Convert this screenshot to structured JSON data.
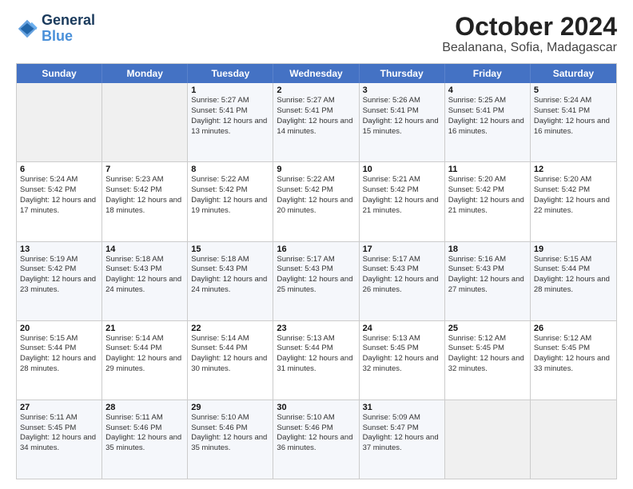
{
  "header": {
    "logo_line1": "General",
    "logo_line2": "Blue",
    "title": "October 2024",
    "subtitle": "Bealanana, Sofia, Madagascar"
  },
  "calendar": {
    "days_of_week": [
      "Sunday",
      "Monday",
      "Tuesday",
      "Wednesday",
      "Thursday",
      "Friday",
      "Saturday"
    ],
    "rows": [
      [
        {
          "day": "",
          "sunrise": "",
          "sunset": "",
          "daylight": "",
          "empty": true
        },
        {
          "day": "",
          "sunrise": "",
          "sunset": "",
          "daylight": "",
          "empty": true
        },
        {
          "day": "1",
          "sunrise": "Sunrise: 5:27 AM",
          "sunset": "Sunset: 5:41 PM",
          "daylight": "Daylight: 12 hours and 13 minutes."
        },
        {
          "day": "2",
          "sunrise": "Sunrise: 5:27 AM",
          "sunset": "Sunset: 5:41 PM",
          "daylight": "Daylight: 12 hours and 14 minutes."
        },
        {
          "day": "3",
          "sunrise": "Sunrise: 5:26 AM",
          "sunset": "Sunset: 5:41 PM",
          "daylight": "Daylight: 12 hours and 15 minutes."
        },
        {
          "day": "4",
          "sunrise": "Sunrise: 5:25 AM",
          "sunset": "Sunset: 5:41 PM",
          "daylight": "Daylight: 12 hours and 16 minutes."
        },
        {
          "day": "5",
          "sunrise": "Sunrise: 5:24 AM",
          "sunset": "Sunset: 5:41 PM",
          "daylight": "Daylight: 12 hours and 16 minutes."
        }
      ],
      [
        {
          "day": "6",
          "sunrise": "Sunrise: 5:24 AM",
          "sunset": "Sunset: 5:42 PM",
          "daylight": "Daylight: 12 hours and 17 minutes."
        },
        {
          "day": "7",
          "sunrise": "Sunrise: 5:23 AM",
          "sunset": "Sunset: 5:42 PM",
          "daylight": "Daylight: 12 hours and 18 minutes."
        },
        {
          "day": "8",
          "sunrise": "Sunrise: 5:22 AM",
          "sunset": "Sunset: 5:42 PM",
          "daylight": "Daylight: 12 hours and 19 minutes."
        },
        {
          "day": "9",
          "sunrise": "Sunrise: 5:22 AM",
          "sunset": "Sunset: 5:42 PM",
          "daylight": "Daylight: 12 hours and 20 minutes."
        },
        {
          "day": "10",
          "sunrise": "Sunrise: 5:21 AM",
          "sunset": "Sunset: 5:42 PM",
          "daylight": "Daylight: 12 hours and 21 minutes."
        },
        {
          "day": "11",
          "sunrise": "Sunrise: 5:20 AM",
          "sunset": "Sunset: 5:42 PM",
          "daylight": "Daylight: 12 hours and 21 minutes."
        },
        {
          "day": "12",
          "sunrise": "Sunrise: 5:20 AM",
          "sunset": "Sunset: 5:42 PM",
          "daylight": "Daylight: 12 hours and 22 minutes."
        }
      ],
      [
        {
          "day": "13",
          "sunrise": "Sunrise: 5:19 AM",
          "sunset": "Sunset: 5:42 PM",
          "daylight": "Daylight: 12 hours and 23 minutes."
        },
        {
          "day": "14",
          "sunrise": "Sunrise: 5:18 AM",
          "sunset": "Sunset: 5:43 PM",
          "daylight": "Daylight: 12 hours and 24 minutes."
        },
        {
          "day": "15",
          "sunrise": "Sunrise: 5:18 AM",
          "sunset": "Sunset: 5:43 PM",
          "daylight": "Daylight: 12 hours and 24 minutes."
        },
        {
          "day": "16",
          "sunrise": "Sunrise: 5:17 AM",
          "sunset": "Sunset: 5:43 PM",
          "daylight": "Daylight: 12 hours and 25 minutes."
        },
        {
          "day": "17",
          "sunrise": "Sunrise: 5:17 AM",
          "sunset": "Sunset: 5:43 PM",
          "daylight": "Daylight: 12 hours and 26 minutes."
        },
        {
          "day": "18",
          "sunrise": "Sunrise: 5:16 AM",
          "sunset": "Sunset: 5:43 PM",
          "daylight": "Daylight: 12 hours and 27 minutes."
        },
        {
          "day": "19",
          "sunrise": "Sunrise: 5:15 AM",
          "sunset": "Sunset: 5:44 PM",
          "daylight": "Daylight: 12 hours and 28 minutes."
        }
      ],
      [
        {
          "day": "20",
          "sunrise": "Sunrise: 5:15 AM",
          "sunset": "Sunset: 5:44 PM",
          "daylight": "Daylight: 12 hours and 28 minutes."
        },
        {
          "day": "21",
          "sunrise": "Sunrise: 5:14 AM",
          "sunset": "Sunset: 5:44 PM",
          "daylight": "Daylight: 12 hours and 29 minutes."
        },
        {
          "day": "22",
          "sunrise": "Sunrise: 5:14 AM",
          "sunset": "Sunset: 5:44 PM",
          "daylight": "Daylight: 12 hours and 30 minutes."
        },
        {
          "day": "23",
          "sunrise": "Sunrise: 5:13 AM",
          "sunset": "Sunset: 5:44 PM",
          "daylight": "Daylight: 12 hours and 31 minutes."
        },
        {
          "day": "24",
          "sunrise": "Sunrise: 5:13 AM",
          "sunset": "Sunset: 5:45 PM",
          "daylight": "Daylight: 12 hours and 32 minutes."
        },
        {
          "day": "25",
          "sunrise": "Sunrise: 5:12 AM",
          "sunset": "Sunset: 5:45 PM",
          "daylight": "Daylight: 12 hours and 32 minutes."
        },
        {
          "day": "26",
          "sunrise": "Sunrise: 5:12 AM",
          "sunset": "Sunset: 5:45 PM",
          "daylight": "Daylight: 12 hours and 33 minutes."
        }
      ],
      [
        {
          "day": "27",
          "sunrise": "Sunrise: 5:11 AM",
          "sunset": "Sunset: 5:45 PM",
          "daylight": "Daylight: 12 hours and 34 minutes."
        },
        {
          "day": "28",
          "sunrise": "Sunrise: 5:11 AM",
          "sunset": "Sunset: 5:46 PM",
          "daylight": "Daylight: 12 hours and 35 minutes."
        },
        {
          "day": "29",
          "sunrise": "Sunrise: 5:10 AM",
          "sunset": "Sunset: 5:46 PM",
          "daylight": "Daylight: 12 hours and 35 minutes."
        },
        {
          "day": "30",
          "sunrise": "Sunrise: 5:10 AM",
          "sunset": "Sunset: 5:46 PM",
          "daylight": "Daylight: 12 hours and 36 minutes."
        },
        {
          "day": "31",
          "sunrise": "Sunrise: 5:09 AM",
          "sunset": "Sunset: 5:47 PM",
          "daylight": "Daylight: 12 hours and 37 minutes."
        },
        {
          "day": "",
          "sunrise": "",
          "sunset": "",
          "daylight": "",
          "empty": true
        },
        {
          "day": "",
          "sunrise": "",
          "sunset": "",
          "daylight": "",
          "empty": true
        }
      ]
    ]
  }
}
